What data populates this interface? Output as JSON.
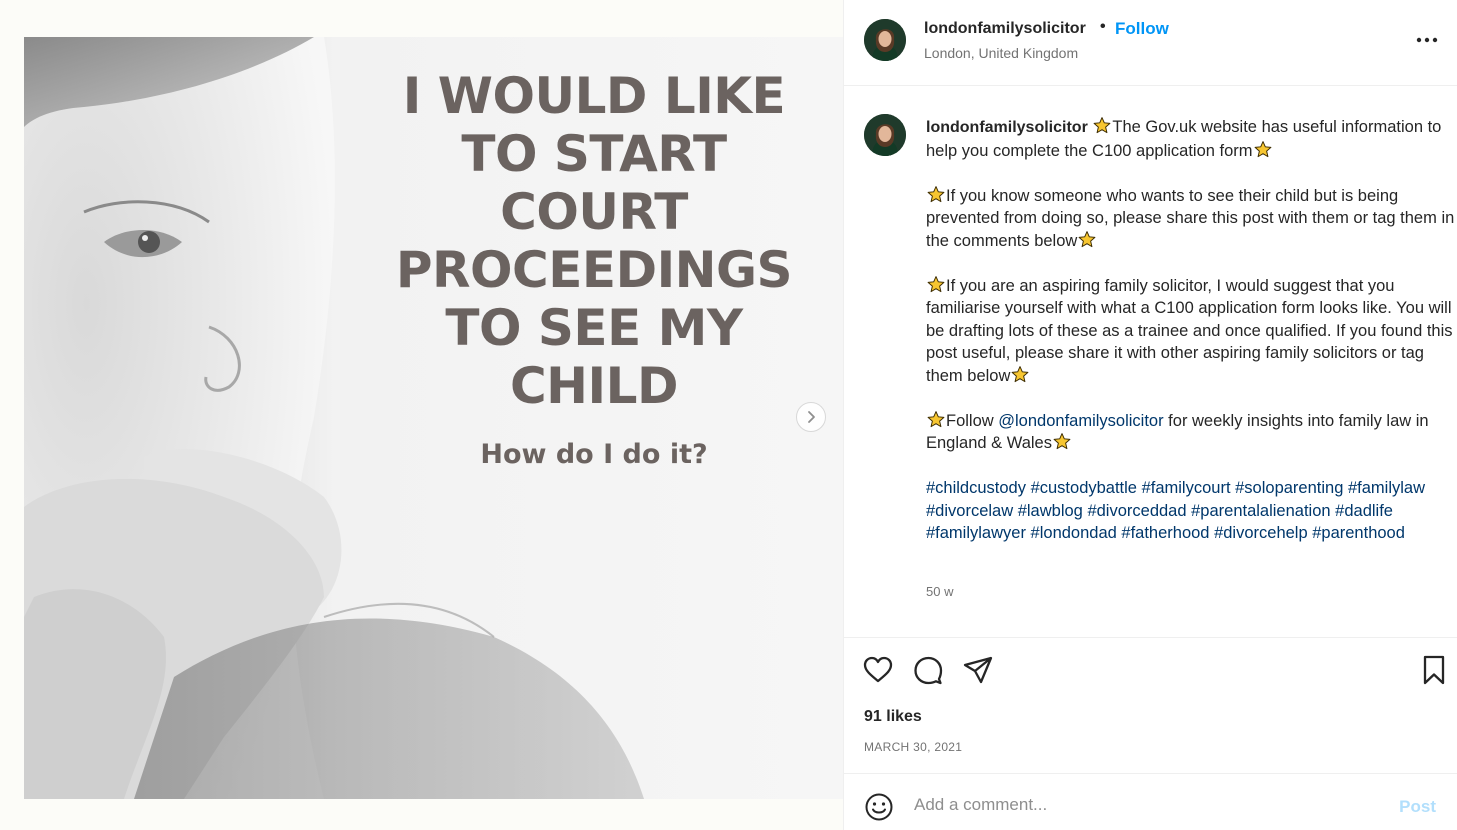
{
  "image": {
    "title": "I WOULD LIKE\nTO START\nCOURT\nPROCEEDINGS\nTO SEE MY\nCHILD",
    "subtitle": "How do I do it?",
    "next_icon": "chevron-right-icon"
  },
  "header": {
    "username": "londonfamilysolicitor",
    "separator": "•",
    "follow_label": "Follow",
    "location": "London, United Kingdom",
    "more_icon": "more-options-icon"
  },
  "caption": {
    "username": "londonfamilysolicitor",
    "p1": "The Gov.uk website has useful information to help you complete the C100 application form",
    "p2": "If you know someone who wants to see their child but is being prevented from doing so, please share this post with them or tag them in the comments below",
    "p3": "If you are an aspiring family solicitor, I would suggest that you familiarise yourself with what a C100 application form looks like. You will be drafting lots of these as a trainee and once qualified. If you found this post useful, please share it with other aspiring family solicitors or tag them below",
    "p4_prefix": "Follow ",
    "p4_mention": "@londonfamilysolicitor",
    "p4_suffix": " for weekly insights into family law in England & Wales",
    "hashtags": [
      "#childcustody",
      "#custodybattle",
      "#familycourt",
      "#soloparenting",
      "#familylaw",
      "#divorcelaw",
      "#lawblog",
      "#divorceddad",
      "#parentalalienation",
      "#dadlife",
      "#familylawyer",
      "#londondad",
      "#fatherhood",
      "#divorcehelp",
      "#parenthood"
    ],
    "time_ago": "50 w"
  },
  "actions": {
    "like_icon": "heart-icon",
    "comment_icon": "comment-icon",
    "share_icon": "share-icon",
    "save_icon": "bookmark-icon",
    "likes": "91 likes",
    "date": "MARCH 30, 2021"
  },
  "comment": {
    "emoji_icon": "emoji-icon",
    "placeholder": "Add a comment...",
    "post_label": "Post"
  },
  "colors": {
    "accent": "#0095f6",
    "link": "#00376b",
    "post_disabled": "#b2dffc",
    "image_text": "#6b6360"
  }
}
